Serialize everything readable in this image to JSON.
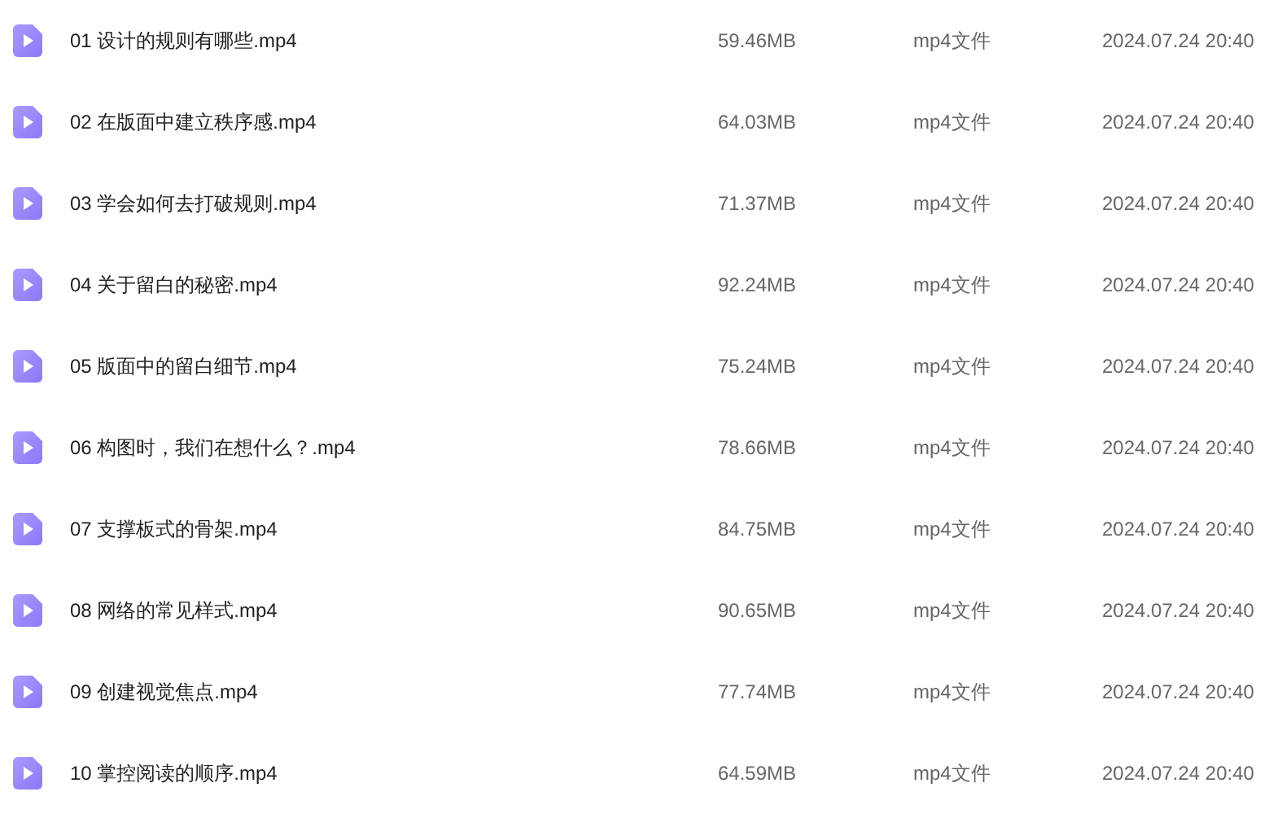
{
  "files": [
    {
      "name": "01 设计的规则有哪些.mp4",
      "size": "59.46MB",
      "type": "mp4文件",
      "date": "2024.07.24 20:40"
    },
    {
      "name": "02 在版面中建立秩序感.mp4",
      "size": "64.03MB",
      "type": "mp4文件",
      "date": "2024.07.24 20:40"
    },
    {
      "name": "03 学会如何去打破规则.mp4",
      "size": "71.37MB",
      "type": "mp4文件",
      "date": "2024.07.24 20:40"
    },
    {
      "name": "04 关于留白的秘密.mp4",
      "size": "92.24MB",
      "type": "mp4文件",
      "date": "2024.07.24 20:40"
    },
    {
      "name": "05 版面中的留白细节.mp4",
      "size": "75.24MB",
      "type": "mp4文件",
      "date": "2024.07.24 20:40"
    },
    {
      "name": "06 构图时，我们在想什么？.mp4",
      "size": "78.66MB",
      "type": "mp4文件",
      "date": "2024.07.24 20:40"
    },
    {
      "name": "07 支撑板式的骨架.mp4",
      "size": "84.75MB",
      "type": "mp4文件",
      "date": "2024.07.24 20:40"
    },
    {
      "name": "08 网络的常见样式.mp4",
      "size": "90.65MB",
      "type": "mp4文件",
      "date": "2024.07.24 20:40"
    },
    {
      "name": "09 创建视觉焦点.mp4",
      "size": "77.74MB",
      "type": "mp4文件",
      "date": "2024.07.24 20:40"
    },
    {
      "name": "10 掌控阅读的顺序.mp4",
      "size": "64.59MB",
      "type": "mp4文件",
      "date": "2024.07.24 20:40"
    }
  ]
}
